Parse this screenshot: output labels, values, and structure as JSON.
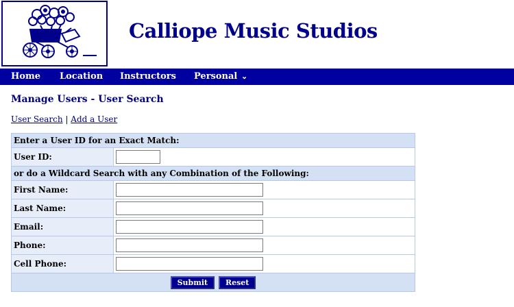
{
  "header": {
    "title": "Calliope Music Studios"
  },
  "nav": {
    "items": [
      "Home",
      "Location",
      "Instructors",
      "Personal"
    ]
  },
  "page": {
    "title": "Manage Users - User Search",
    "links": {
      "search": "User Search",
      "separator": "|",
      "add": "Add a User"
    }
  },
  "form": {
    "exact_header": "Enter a User ID for an Exact Match:",
    "userid_label": "User ID:",
    "wildcard_header": "or do a Wildcard Search with any Combination of the Following:",
    "fields": [
      {
        "label": "First Name:",
        "value": ""
      },
      {
        "label": "Last Name:",
        "value": ""
      },
      {
        "label": "Email:",
        "value": ""
      },
      {
        "label": "Phone:",
        "value": ""
      },
      {
        "label": "Cell Phone:",
        "value": ""
      }
    ],
    "submit_label": "Submit",
    "reset_label": "Reset"
  },
  "colors": {
    "brand": "#00008b",
    "nav": "#0000a0",
    "section": "#d4e0f4",
    "label_bg": "#e8eef9"
  }
}
